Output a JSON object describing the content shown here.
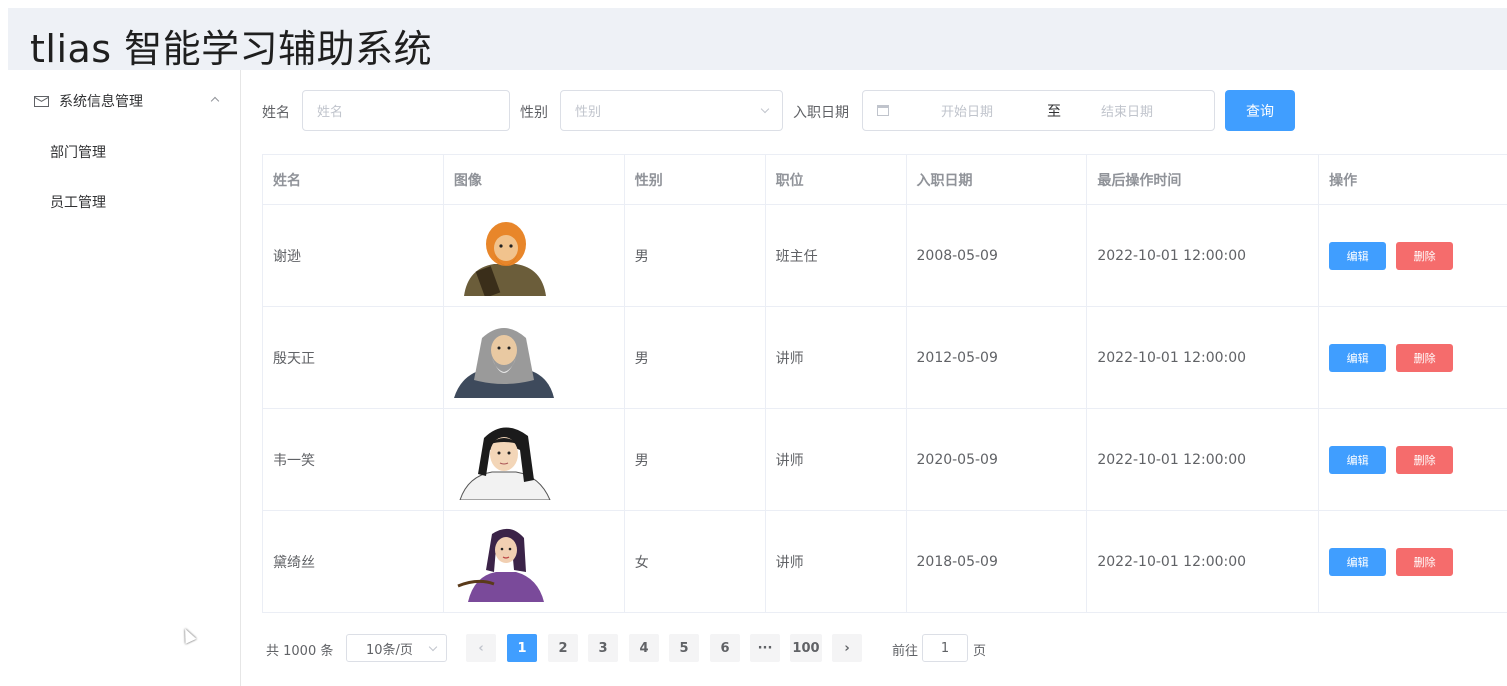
{
  "app": {
    "title": "tlias 智能学习辅助系统"
  },
  "sidebar": {
    "group": {
      "label": "系统信息管理",
      "icon": "mail-icon"
    },
    "items": [
      {
        "label": "部门管理"
      },
      {
        "label": "员工管理"
      }
    ]
  },
  "search": {
    "name_label": "姓名",
    "name_placeholder": "姓名",
    "gender_label": "性别",
    "gender_placeholder": "性别",
    "date_label": "入职日期",
    "start_placeholder": "开始日期",
    "range_separator": "至",
    "end_placeholder": "结束日期",
    "query_button": "查询"
  },
  "table": {
    "headers": [
      "姓名",
      "图像",
      "性别",
      "职位",
      "入职日期",
      "最后操作时间",
      "操作"
    ],
    "rows": [
      {
        "name": "谢逊",
        "gender": "男",
        "position": "班主任",
        "entry_date": "2008-05-09",
        "update_time": "2022-10-01 12:00:00",
        "avatar": "orange-bearded-warrior"
      },
      {
        "name": "殷天正",
        "gender": "男",
        "position": "讲师",
        "entry_date": "2012-05-09",
        "update_time": "2022-10-01 12:00:00",
        "avatar": "grey-haired-elder"
      },
      {
        "name": "韦一笑",
        "gender": "男",
        "position": "讲师",
        "entry_date": "2020-05-09",
        "update_time": "2022-10-01 12:00:00",
        "avatar": "black-haired-swordsman"
      },
      {
        "name": "黛绮丝",
        "gender": "女",
        "position": "讲师",
        "entry_date": "2018-05-09",
        "update_time": "2022-10-01 12:00:00",
        "avatar": "purple-robed-lady"
      }
    ],
    "edit_label": "编辑",
    "delete_label": "删除"
  },
  "pagination": {
    "total": "共 1000 条",
    "page_size": "10条/页",
    "pages": [
      "1",
      "2",
      "3",
      "4",
      "5",
      "6",
      "···",
      "100"
    ],
    "current": "1",
    "prev_icon": "chevron-left-icon",
    "next_icon": "chevron-right-icon",
    "goto_label": "前往",
    "goto_value": "1",
    "goto_suffix": "页"
  },
  "colors": {
    "primary": "#409eff",
    "danger": "#f56c6c",
    "header_bg": "#eef1f6"
  }
}
